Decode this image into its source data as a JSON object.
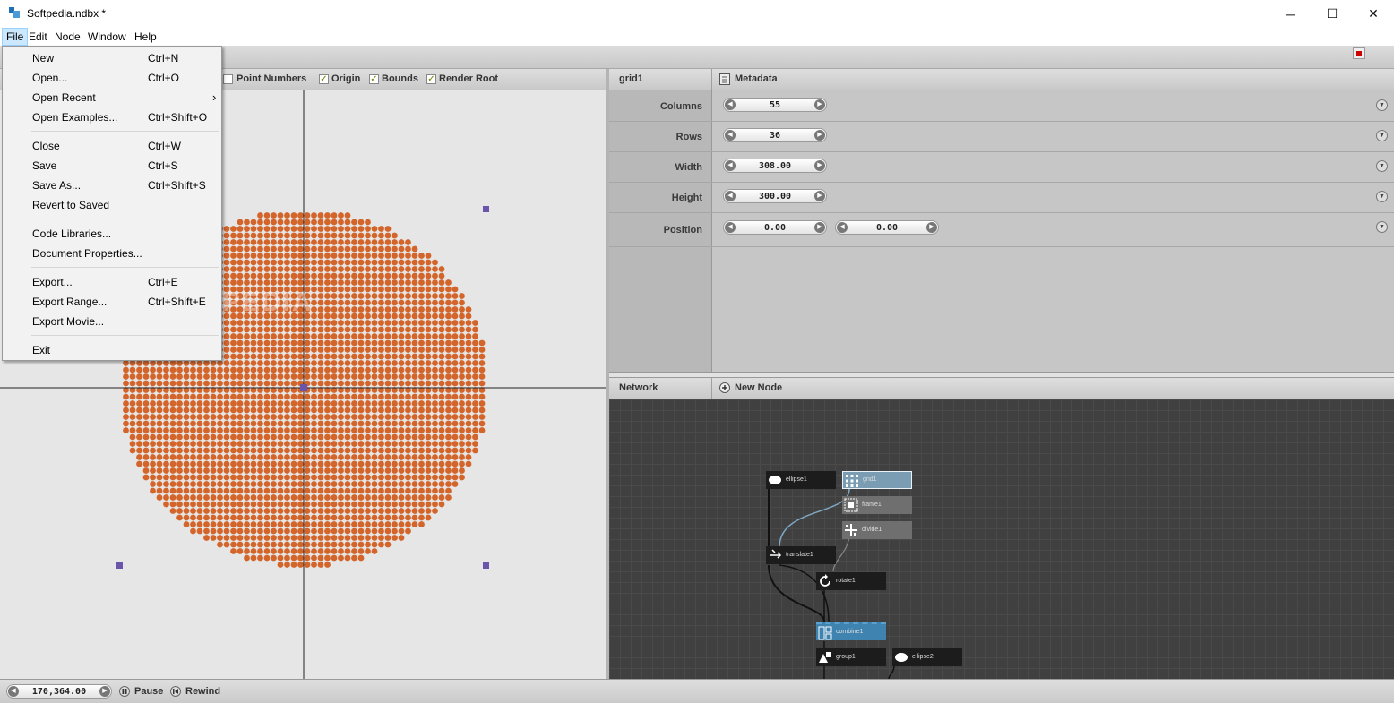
{
  "window": {
    "title": "Softpedia.ndbx *",
    "minimize_glyph": "─",
    "maximize_glyph": "☐",
    "close_glyph": "✕"
  },
  "menubar": [
    "File",
    "Edit",
    "Node",
    "Window",
    "Help"
  ],
  "file_menu": {
    "items": [
      {
        "label": "New",
        "shortcut": "Ctrl+N"
      },
      {
        "label": "Open...",
        "shortcut": "Ctrl+O"
      },
      {
        "label": "Open Recent",
        "shortcut": "",
        "submenu": true
      },
      {
        "label": "Open Examples...",
        "shortcut": "Ctrl+Shift+O"
      },
      {
        "label": "Close",
        "shortcut": "Ctrl+W"
      },
      {
        "label": "Save",
        "shortcut": "Ctrl+S"
      },
      {
        "label": "Save As...",
        "shortcut": "Ctrl+Shift+S"
      },
      {
        "label": "Revert to Saved",
        "shortcut": ""
      },
      {
        "label": "Code Libraries...",
        "shortcut": ""
      },
      {
        "label": "Document Properties...",
        "shortcut": ""
      },
      {
        "label": "Export...",
        "shortcut": "Ctrl+E"
      },
      {
        "label": "Export Range...",
        "shortcut": "Ctrl+Shift+E"
      },
      {
        "label": "Export Movie...",
        "shortcut": ""
      },
      {
        "label": "Exit",
        "shortcut": ""
      }
    ],
    "submenu_arrow": "›"
  },
  "viewer_toolbar": {
    "options": [
      {
        "label": "Point Numbers",
        "checked": false
      },
      {
        "label": "Origin",
        "checked": true
      },
      {
        "label": "Bounds",
        "checked": true
      },
      {
        "label": "Render Root",
        "checked": true
      }
    ],
    "check_glyph": "✓"
  },
  "viewer": {
    "watermark": "SOFTPEDIA",
    "dot_color": "#d4652a",
    "handle_color": "#6a55aa"
  },
  "parameters": {
    "node_name": "grid1",
    "metadata_label": "Metadata",
    "rows": [
      {
        "label": "Columns",
        "values": [
          "55"
        ]
      },
      {
        "label": "Rows",
        "values": [
          "36"
        ]
      },
      {
        "label": "Width",
        "values": [
          "308.00"
        ]
      },
      {
        "label": "Height",
        "values": [
          "300.00"
        ]
      },
      {
        "label": "Position",
        "values": [
          "0.00",
          "0.00"
        ]
      }
    ],
    "arrow_left": "◀",
    "arrow_right": "▶",
    "row_menu_glyph": "▼"
  },
  "network": {
    "title": "Network",
    "new_node_label": "New Node",
    "new_node_icon": "plus-icon",
    "nodes": [
      {
        "name": "ellipse1",
        "icon": "ellipse-icon",
        "style": "dark"
      },
      {
        "name": "grid1",
        "icon": "grid-icon",
        "style": "selected"
      },
      {
        "name": "frame1",
        "icon": "frame-icon",
        "style": "gray"
      },
      {
        "name": "divide1",
        "icon": "divide-icon",
        "style": "gray"
      },
      {
        "name": "translate1",
        "icon": "translate-icon",
        "style": "dark"
      },
      {
        "name": "rotate1",
        "icon": "rotate-icon",
        "style": "dark"
      },
      {
        "name": "combine1",
        "icon": "combine-icon",
        "style": "blue"
      },
      {
        "name": "group1",
        "icon": "group-icon",
        "style": "dark"
      },
      {
        "name": "ellipse2",
        "icon": "ellipse-icon",
        "style": "dark"
      }
    ],
    "colors": {
      "dark": "#1c1c1c",
      "gray": "#6f6f6f",
      "selected": "#7a9db3",
      "blue": "#3f84b0"
    }
  },
  "statusbar": {
    "frame_value": "170,364.00",
    "pause_label": "Pause",
    "rewind_label": "Rewind"
  }
}
